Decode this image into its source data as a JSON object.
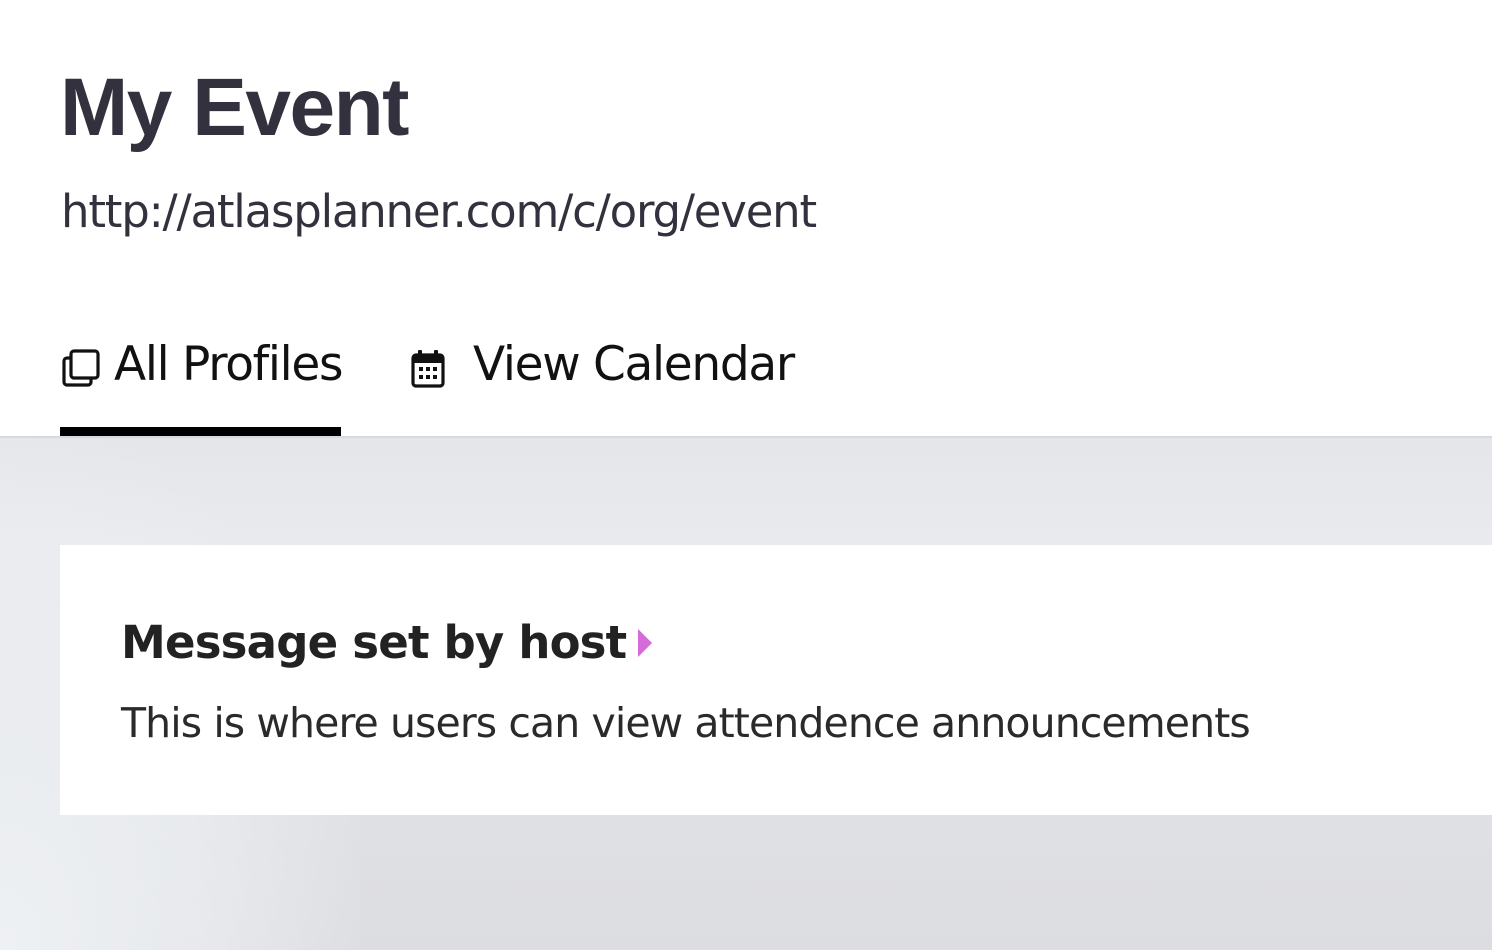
{
  "header": {
    "title": "My Event",
    "url": "http://atlasplanner.com/c/org/event"
  },
  "tabs": [
    {
      "label": "All Profiles",
      "icon": "copy-icon",
      "active": true
    },
    {
      "label": "View Calendar",
      "icon": "calendar-icon",
      "active": false
    }
  ],
  "message": {
    "title": "Message set by host",
    "body": "This is where users can view attendence announcements",
    "toggle_icon": "caret-right-icon"
  },
  "colors": {
    "title_text": "#33313d",
    "active_tab_indicator": "#000000",
    "accent_caret": "#d56ad8",
    "content_background": "#e4e6ea",
    "card_background": "#ffffff"
  }
}
